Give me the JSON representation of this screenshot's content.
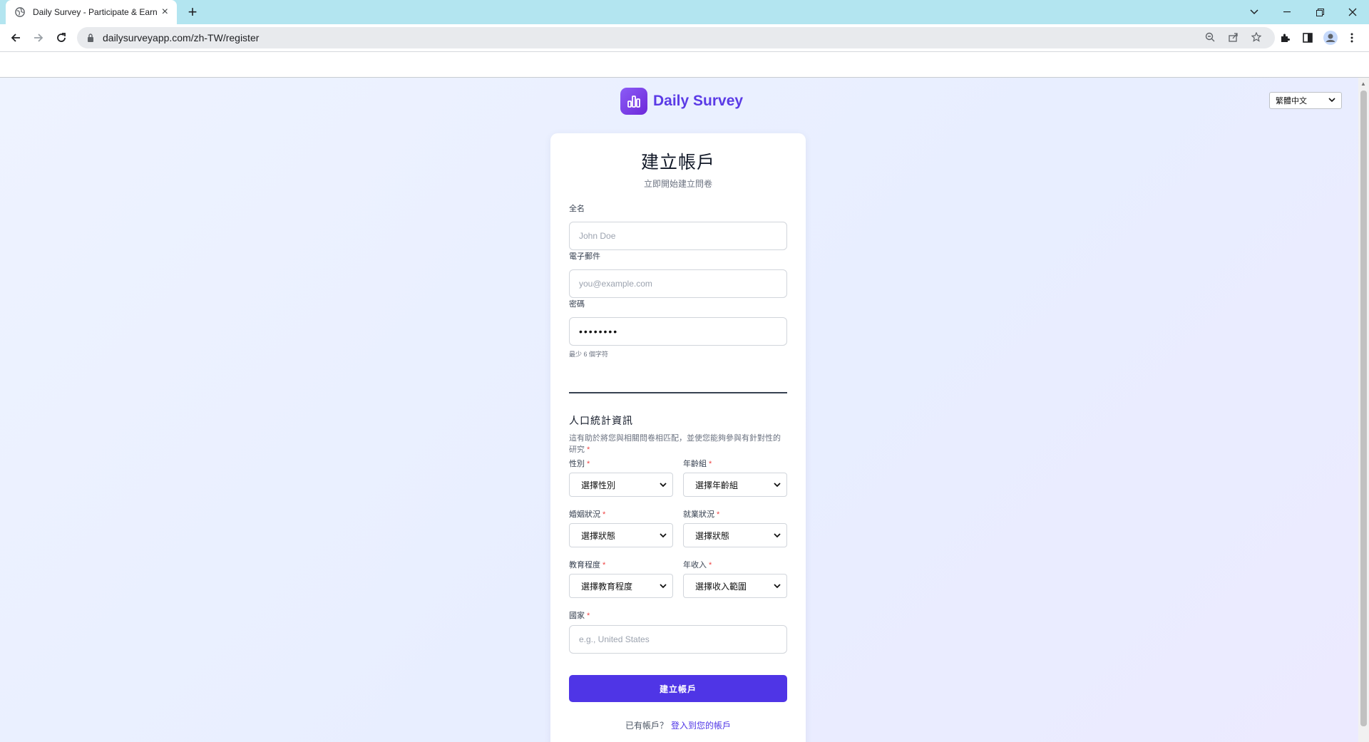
{
  "browser": {
    "tab_title": "Daily Survey - Participate & Earn",
    "url": "dailysurveyapp.com/zh-TW/register",
    "new_tab_label": "+",
    "tab_close_label": "×"
  },
  "header": {
    "brand_name": "Daily Survey",
    "language_selected": "繁體中文"
  },
  "form": {
    "title": "建立帳戶",
    "subtitle": "立即開始建立問卷",
    "full_name_label": "全名",
    "full_name_placeholder": "John Doe",
    "email_label": "電子郵件",
    "email_placeholder": "you@example.com",
    "password_label": "密碼",
    "password_value": "••••••••",
    "password_hint": "最少 6 個字符",
    "demographics_title": "人口統計資訊",
    "demographics_desc": "這有助於將您與相關問卷相匹配，並使您能夠參與有針對性的研究",
    "required_mark": "*",
    "gender_label": "性別",
    "gender_value": "選擇性別",
    "age_label": "年齡組",
    "age_value": "選擇年齡組",
    "marital_label": "婚姻狀況",
    "marital_value": "選擇狀態",
    "employment_label": "就業狀況",
    "employment_value": "選擇狀態",
    "education_label": "教育程度",
    "education_value": "選擇教育程度",
    "income_label": "年收入",
    "income_value": "選擇收入範圍",
    "country_label": "國家",
    "country_placeholder": "e.g., United States",
    "submit_label": "建立帳戶",
    "have_account_text": "已有帳戶？",
    "login_link": "登入到您的帳戶"
  },
  "colors": {
    "accent": "#4f35e6",
    "brand_text": "#5b3be6",
    "tabstrip": "#b3e5f0"
  }
}
